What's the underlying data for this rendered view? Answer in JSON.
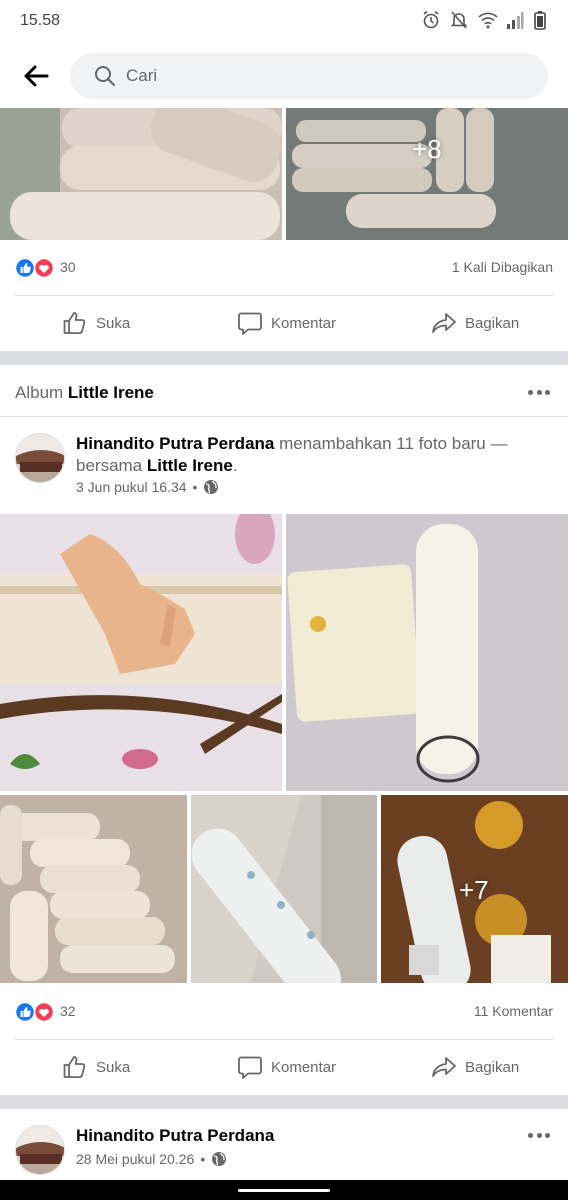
{
  "status_bar": {
    "time": "15.58"
  },
  "search": {
    "placeholder": "Cari"
  },
  "colors": {
    "like_blue": "#1877f2",
    "love_red": "#f33e58",
    "secondary_text": "#65676b",
    "separator": "#dadde1"
  },
  "post1": {
    "photo_overflow": "+8",
    "reaction_count": "30",
    "share_count": "1 Kali Dibagikan",
    "actions": {
      "like": "Suka",
      "comment": "Komentar",
      "share": "Bagikan"
    }
  },
  "album": {
    "label": "Album",
    "name": "Little Irene"
  },
  "post2": {
    "author": "Hinandito Putra Perdana",
    "action_text": "menambahkan 11 foto baru — bersama",
    "tagged": "Little Irene",
    "period": ".",
    "timestamp": "3 Jun pukul 16.34",
    "photo_overflow": "+7",
    "reaction_count": "32",
    "comment_count": "11 Komentar",
    "actions": {
      "like": "Suka",
      "comment": "Komentar",
      "share": "Bagikan"
    }
  },
  "post3": {
    "author": "Hinandito Putra Perdana",
    "timestamp": "28 Mei pukul 20.26"
  }
}
